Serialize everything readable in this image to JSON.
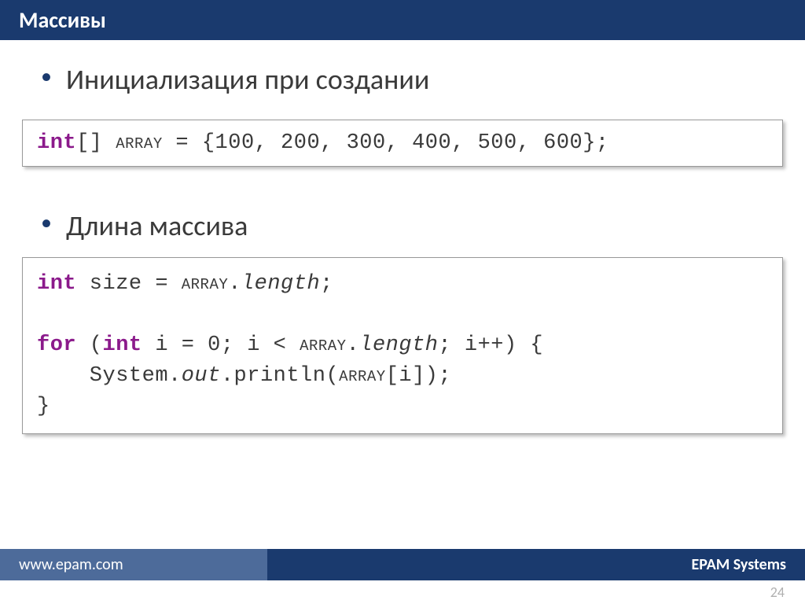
{
  "header": {
    "title": "Массивы"
  },
  "sections": [
    {
      "bullet": "Инициализация при создании",
      "code_html": "<span class='kw'>int</span>[] <span class='ident'>array</span> = {100, 200, 300, 400, 500, 600};"
    },
    {
      "bullet": "Длина массива",
      "code_html": "<span class='kw'>int</span> size = <span class='ident'>array</span>.<span class='mem'>length</span>;<br><br><span class='kw'>for</span> (<span class='kw'>int</span> i = 0; i &lt; <span class='ident'>array</span>.<span class='mem'>length</span>; i++) {<br>&nbsp;&nbsp;&nbsp;&nbsp;System.<span class='mem'>out</span>.println(<span class='ident'>array</span>[i]);<br>}"
    }
  ],
  "footer": {
    "url": "www.epam.com",
    "company": "EPAM Systems"
  },
  "page_number": "24"
}
